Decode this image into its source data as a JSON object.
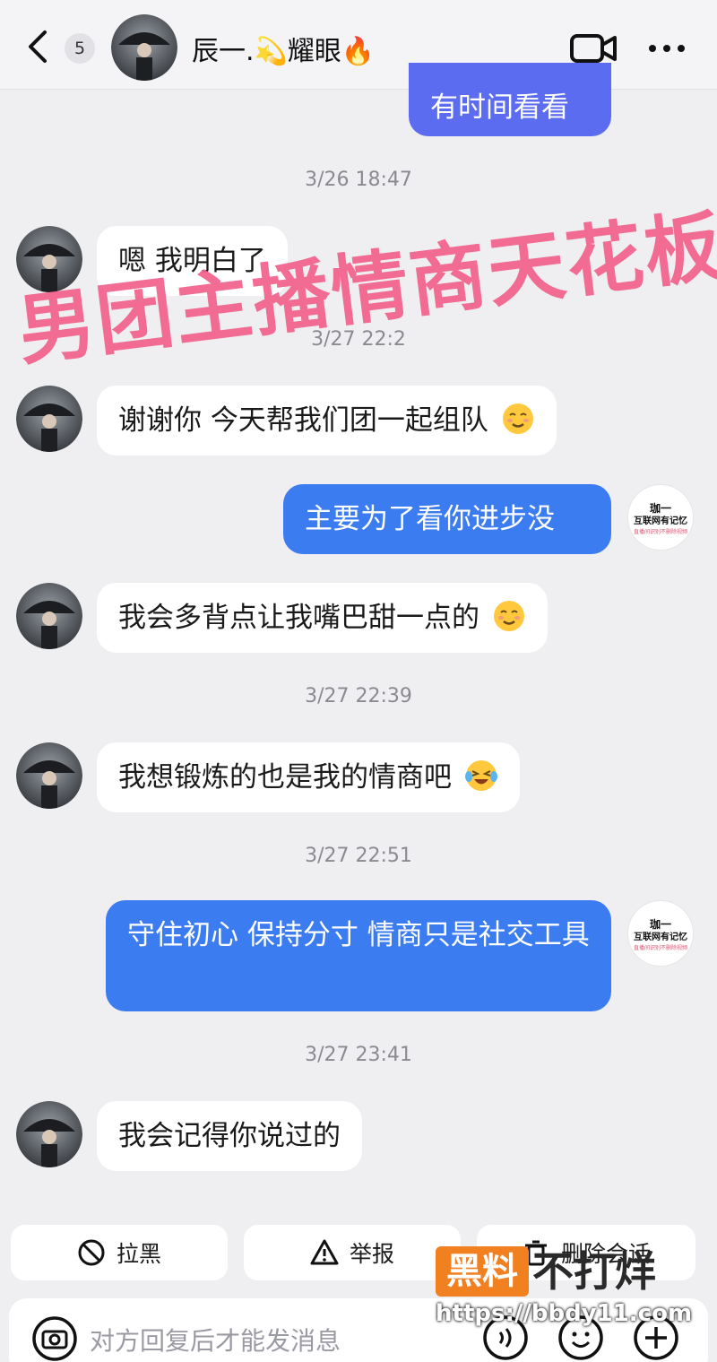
{
  "header": {
    "unread_count": "5",
    "contact_name": "辰一.💫耀眼🔥"
  },
  "overlay_caption": "男团主播情商天花板",
  "messages": [
    {
      "type": "out",
      "text": "有时间看看"
    },
    {
      "type": "time",
      "text": "3/26 18:47"
    },
    {
      "type": "in",
      "text": "嗯 我明白了"
    },
    {
      "type": "time",
      "text": "3/27 22:2"
    },
    {
      "type": "in",
      "text": "谢谢你 今天帮我们团一起组队"
    },
    {
      "type": "out",
      "text": "主要为了看你进步没"
    },
    {
      "type": "in",
      "text": "我会多背点让我嘴巴甜一点的"
    },
    {
      "type": "time",
      "text": "3/27 22:39"
    },
    {
      "type": "in",
      "text": "我想锻炼的也是我的情商吧"
    },
    {
      "type": "time",
      "text": "3/27 22:51"
    },
    {
      "type": "out",
      "text": "守住初心 保持分寸 情商只是社交工具"
    },
    {
      "type": "time",
      "text": "3/27 23:41"
    },
    {
      "type": "in",
      "text": "我会记得你说过的"
    }
  ],
  "self_avatar": {
    "line1": "珈一",
    "line2": "互联网有记忆",
    "line3": "直播间识别不删除视频"
  },
  "actions": {
    "block_label": "拉黑",
    "report_label": "举报",
    "delete_label": "删除会话"
  },
  "input": {
    "placeholder": "对方回复后才能发消息"
  },
  "watermark": {
    "badge": "黑料",
    "text": "不打烊",
    "url": "https://bbdy11.com"
  },
  "colors": {
    "outgoing_bubble": "#3b7cf0",
    "incoming_bubble": "#ffffff",
    "overlay_caption": "#f2608c",
    "watermark_badge": "#f08020"
  }
}
